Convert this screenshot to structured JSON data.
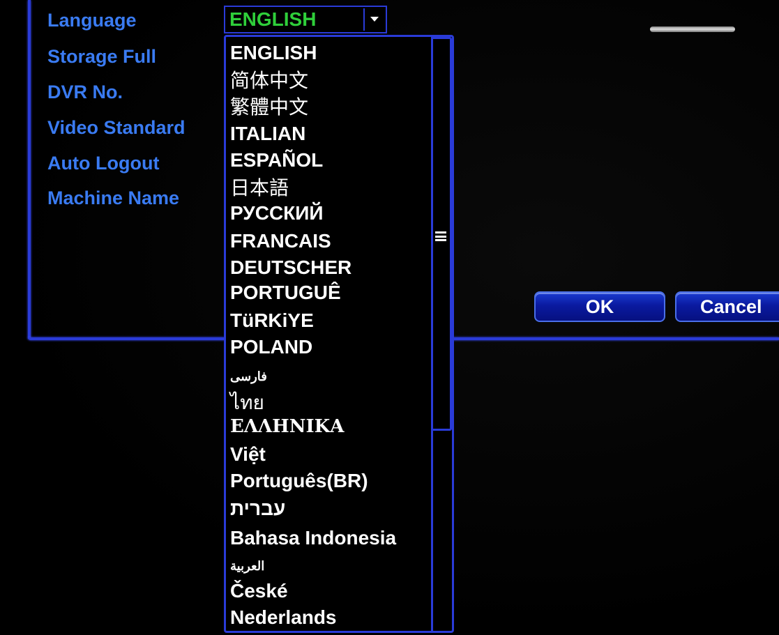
{
  "settings": {
    "labels": [
      "Language",
      "Storage Full",
      "DVR No.",
      "Video Standard",
      "Auto Logout",
      "Machine Name"
    ]
  },
  "language_select": {
    "selected": "ENGLISH"
  },
  "dropdown": {
    "options": [
      "ENGLISH",
      "简体中文",
      "繁體中文",
      "ITALIAN",
      "ESPAÑOL",
      "日本語",
      "РУССКИЙ",
      "FRANCAIS",
      "DEUTSCHER",
      "PORTUGUÊ",
      "TüRKiYE",
      "POLAND",
      "فارسی",
      "ไทย",
      "ΕΛΛΗΝΙΚΑ",
      "Việt",
      "Português(BR)",
      "עברית",
      "Bahasa Indonesia",
      "العربية",
      "České",
      "Nederlands"
    ]
  },
  "buttons": {
    "ok": "OK",
    "cancel": "Cancel"
  },
  "colors": {
    "label_blue": "#3a7bf2",
    "selected_green": "#2fcf3a",
    "frame_blue": "#2a3bd8"
  }
}
